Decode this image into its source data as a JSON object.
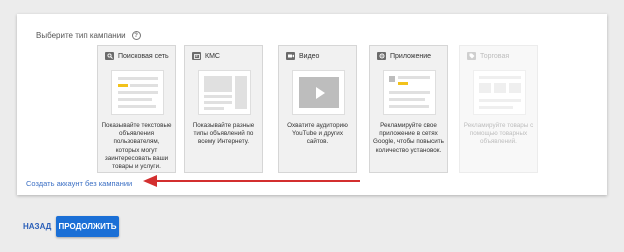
{
  "header": {
    "title": "Выберите тип кампании",
    "help_icon": "?"
  },
  "cards": [
    {
      "label": "Поисковая сеть",
      "icon": "search-icon",
      "description": "Показывайте текстовые объявления пользователям, которых могут заинтересовать ваши товары и услуги.",
      "disabled": false
    },
    {
      "label": "КМС",
      "icon": "display-icon",
      "description": "Показывайте разные типы объявлений по всему Интернету.",
      "disabled": false
    },
    {
      "label": "Видео",
      "icon": "video-camera-icon",
      "description": "Охватите аудиторию YouTube и других сайтов.",
      "disabled": false
    },
    {
      "label": "Приложение",
      "icon": "app-icon",
      "description": "Рекламируйте свое приложение в сетях Google, чтобы повысить количество установок.",
      "disabled": false
    },
    {
      "label": "Торговая",
      "icon": "shopping-tag-icon",
      "description": "Рекламируйте товары с помощью товарных объявлений.",
      "disabled": true
    }
  ],
  "create_account_link": "Создать аккаунт без кампании",
  "footer": {
    "back_label": "НАЗАД",
    "continue_label": "ПРОДОЛЖИТЬ"
  },
  "colors": {
    "primary": "#1a6fd6",
    "link": "#3b6fc4",
    "arrow": "#d32f2f",
    "highlight": "#f2c21b"
  }
}
